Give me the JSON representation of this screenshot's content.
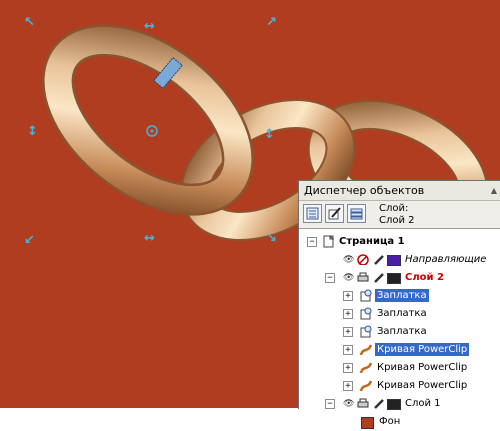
{
  "docker": {
    "title": "Диспетчер объектов",
    "layer_caption": "Слой:",
    "layer_current": "Слой 2",
    "toolbar_icons": [
      "show-properties-icon",
      "edit-across-layers-icon",
      "layer-manager-view-icon"
    ]
  },
  "tree": {
    "page": {
      "label": "Страница 1",
      "expander": "−"
    },
    "guides": {
      "label": "Направляющие",
      "color": "#4a1fa5"
    },
    "layer2": {
      "label": "Слой 2",
      "expander": "−",
      "color": "#222222",
      "label_color": "#d00000"
    },
    "layer2_items": [
      {
        "label": "Заплатка",
        "icon": "envelope-effect-icon",
        "selected": true
      },
      {
        "label": "Заплатка",
        "icon": "envelope-effect-icon",
        "selected": false
      },
      {
        "label": "Заплатка",
        "icon": "envelope-effect-icon",
        "selected": false
      },
      {
        "label": "Кривая PowerClip",
        "icon": "curve-icon",
        "selected": true
      },
      {
        "label": "Кривая PowerClip",
        "icon": "curve-icon",
        "selected": false
      },
      {
        "label": "Кривая PowerClip",
        "icon": "curve-icon",
        "selected": false
      }
    ],
    "layer1": {
      "label": "Слой 1",
      "expander": "−",
      "color": "#222222"
    },
    "background": {
      "label": "Фон",
      "color": "#b13d20"
    }
  },
  "colors": {
    "canvas_background": "#b13d20",
    "chain_gold": "#d9a878",
    "selection_handles": "#49b3d9",
    "selection_highlight": "#3569c9"
  }
}
